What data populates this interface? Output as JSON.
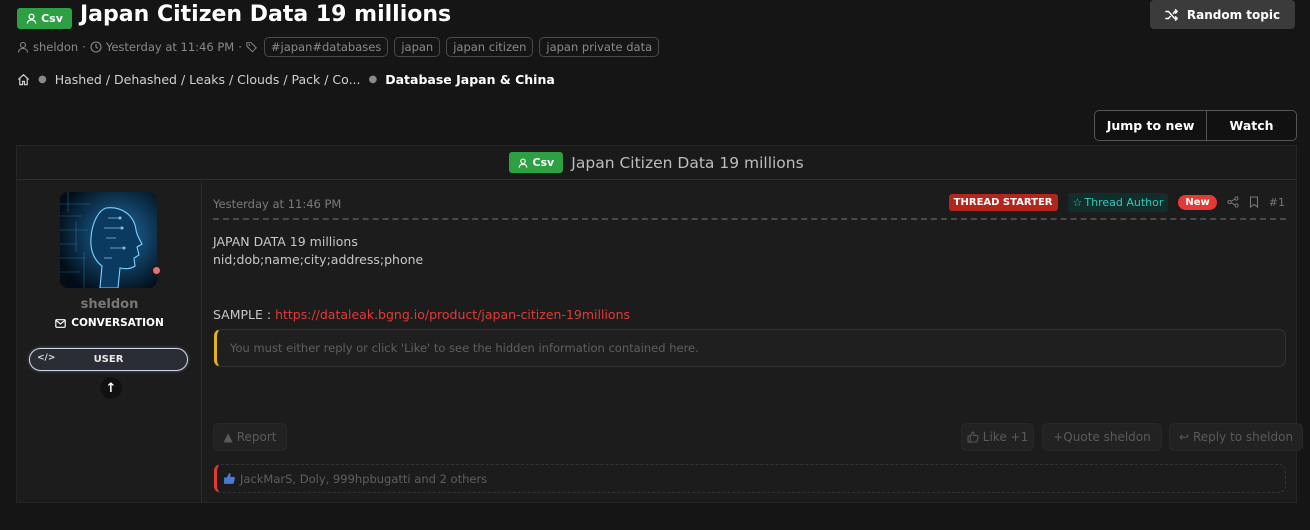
{
  "header": {
    "prefix_badge": "Csv",
    "title": "Japan Citizen Data 19 millions",
    "random_topic_label": "Random topic"
  },
  "meta": {
    "author": "sheldon",
    "date": "Yesterday at 11:46 PM",
    "separator": "·",
    "tags": [
      "#japan#databases",
      "japan",
      "japan citizen",
      "japan private data"
    ]
  },
  "breadcrumb": {
    "items": [
      "Hashed / Dehashed / Leaks / Clouds / Pack / Co...",
      "Database Japan & China"
    ]
  },
  "thread_actions": {
    "jump_label": "Jump to new",
    "watch_label": "Watch"
  },
  "thread": {
    "prefix_badge": "Csv",
    "title": "Japan Citizen Data 19 millions"
  },
  "user": {
    "name": "sheldon",
    "conversation_label": "CONVERSATION",
    "role_badge": "USER"
  },
  "post": {
    "date": "Yesterday at 11:46 PM",
    "badges": {
      "starter": "THREAD STARTER",
      "author": "Thread Author",
      "new": "New"
    },
    "number": "#1",
    "lines": [
      "JAPAN DATA 19 millions",
      "nid;dob;name;city;address;phone"
    ],
    "sample_label": "SAMPLE : ",
    "sample_link": "https://dataleak.bgng.io/product/japan-citizen-19millions",
    "hidden_notice": "You must either reply or click 'Like' to see the hidden information contained here.",
    "actions": {
      "report": "Report",
      "like": "Like +1",
      "quote": "+Quote sheldon",
      "reply": "Reply to sheldon"
    },
    "reactions": "JackMarS, Doly, 999hpbugatti and 2 others"
  },
  "colors": {
    "background": "#151515",
    "badge_green": "#2ea043",
    "accent_red": "#e53935",
    "author_teal": "#2fc9b8",
    "hidden_border": "#e6b422"
  }
}
